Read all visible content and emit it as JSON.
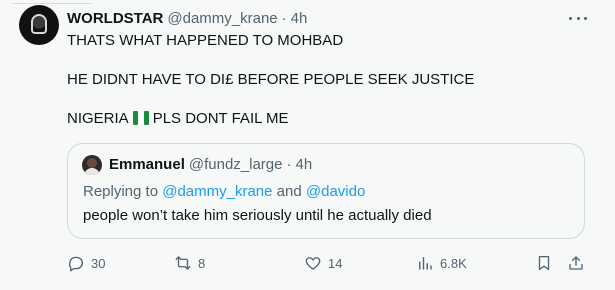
{
  "tweet": {
    "display_name": "WORLDSTAR",
    "handle": "@dammy_krane",
    "separator": "·",
    "time": "4h",
    "lines": [
      "THATS WHAT HAPPENED TO MOHBAD",
      "HE DIDNT HAVE TO DI£ BEFORE PEOPLE SEEK JUSTICE",
      "NIGERIA",
      "PLS DONT FAIL ME"
    ],
    "flag_icon": "nigeria-flag-icon",
    "more_icon": "more-options-icon"
  },
  "quote": {
    "display_name": "Emmanuel",
    "handle": "@fundz_large",
    "separator": "·",
    "time": "4h",
    "replying_prefix": "Replying to ",
    "mention_1": "@dammy_krane",
    "conjunction": " and ",
    "mention_2": "@davido",
    "text": "people won’t take him seriously until he actually died"
  },
  "actions": {
    "replies": "30",
    "retweets": "8",
    "likes": "14",
    "views": "6.8K"
  },
  "colors": {
    "text_primary": "#0f1419",
    "text_secondary": "#536471",
    "link": "#1d9bf0",
    "border": "#cfd9de",
    "background": "#f7f9f9",
    "flag_green": "#1a8b3a"
  }
}
